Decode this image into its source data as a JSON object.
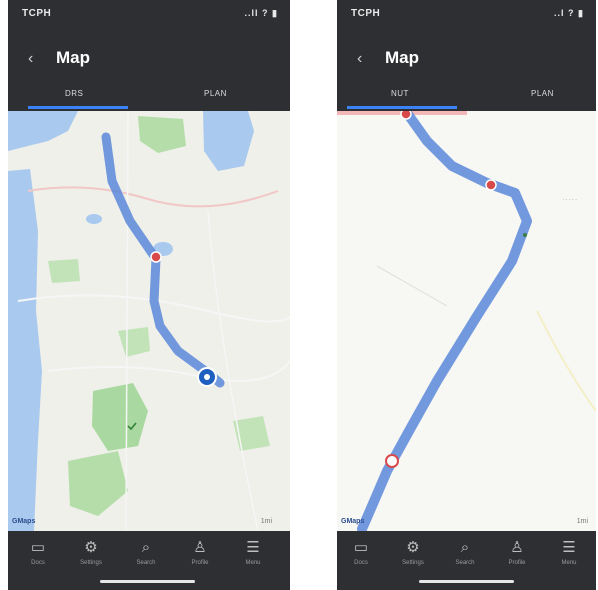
{
  "screens": [
    {
      "status_time": "TCPH",
      "status_icons": "..ll ? ▮",
      "back_icon": "back-chevron-icon",
      "title": "Map",
      "tabs": [
        "DRS",
        "PLAN"
      ],
      "map_corner_label": "GMaps",
      "map_scale_label": "1mi",
      "nav_items": [
        {
          "icon": "document-icon",
          "label": "Docs"
        },
        {
          "icon": "settings-icon",
          "label": "Settings"
        },
        {
          "icon": "search-icon",
          "label": "Search"
        },
        {
          "icon": "person-icon",
          "label": "Profile"
        },
        {
          "icon": "menu-icon",
          "label": "Menu"
        }
      ]
    },
    {
      "status_time": "TCPH",
      "status_icons": "..l ? ▮",
      "back_icon": "back-chevron-icon",
      "title": "Map",
      "tabs": [
        "NUT",
        "PLAN"
      ],
      "map_corner_label": "GMaps",
      "map_scale_label": "1mi",
      "nav_items": [
        {
          "icon": "document-icon",
          "label": "Docs"
        },
        {
          "icon": "settings-icon",
          "label": "Settings"
        },
        {
          "icon": "search-icon",
          "label": "Search"
        },
        {
          "icon": "person-icon",
          "label": "Profile"
        },
        {
          "icon": "menu-icon",
          "label": "Menu"
        }
      ]
    }
  ],
  "colors": {
    "header_bg": "#2d2f33",
    "route_blue": "#5b87d9",
    "water": "#a9c9ef",
    "park_green": "#a9d9a0",
    "map_land": "#eef0e9",
    "marker_red": "#d84a4a",
    "pin_blue": "#1f5fbf"
  }
}
